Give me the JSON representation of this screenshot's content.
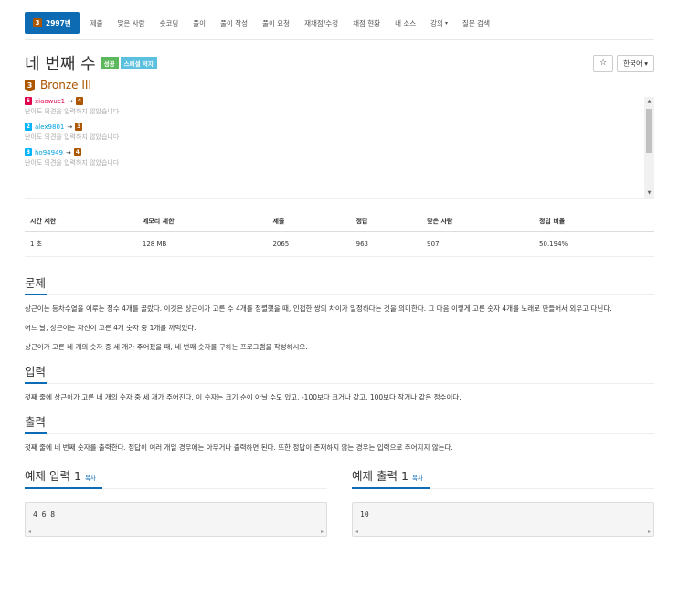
{
  "nav": {
    "tabs": [
      {
        "label": "2997번",
        "active": true
      },
      {
        "label": "제출"
      },
      {
        "label": "맞은 사람"
      },
      {
        "label": "숏코딩"
      },
      {
        "label": "풀이"
      },
      {
        "label": "풀이 작성"
      },
      {
        "label": "풀이 요청"
      },
      {
        "label": "재채점/수정"
      },
      {
        "label": "채점 현황"
      },
      {
        "label": "내 소스"
      },
      {
        "label": "강의"
      },
      {
        "label": "질문 검색"
      }
    ],
    "active_icon": "3"
  },
  "problem": {
    "title": "네 번째 수",
    "badge_success": "성공",
    "badge_special": "스페셜 저지",
    "tier_icon": "3",
    "tier_label": "Bronze III"
  },
  "tools": {
    "star": "☆",
    "language": "한국어"
  },
  "opinions": [
    {
      "level": "5",
      "level_tier": "ruby",
      "user": "xiaowuc1",
      "user_color": "red",
      "arrow": "→",
      "vote": "4",
      "note": "난이도 의견을 입력하지 않았습니다"
    },
    {
      "level": "2",
      "level_tier": "diamond",
      "user": "alex9801",
      "user_color": "blue",
      "arrow": "→",
      "vote": "3",
      "note": "난이도 의견을 입력하지 않았습니다"
    },
    {
      "level": "3",
      "level_tier": "diamond",
      "user": "ho94949",
      "user_color": "blue",
      "arrow": "→",
      "vote": "4",
      "note": "난이도 의견을 입력하지 않았습니다"
    }
  ],
  "info_table": {
    "headers": [
      "시간 제한",
      "메모리 제한",
      "제출",
      "정답",
      "맞은 사람",
      "정답 비율"
    ],
    "row": [
      "1 초",
      "128 MB",
      "2065",
      "963",
      "907",
      "50.194%"
    ]
  },
  "sections": {
    "problem_title": "문제",
    "problem_paragraphs": [
      "상근이는 등차수열을 이루는 정수 4개를 골랐다. 이것은 상근이가 고른 수 4개를 정렬했을 때, 인접한 쌍의 차이가 일정하다는 것을 의미한다. 그 다음 이렇게 고른 숫자 4개를 노래로 만들어서 외우고 다닌다.",
      "어느 날, 상근이는 자신이 고른 4개 숫자 중 1개를 까먹었다.",
      "상근이가 고른 네 개의 숫자 중 세 개가 주어졌을 때, 네 번째 숫자를 구하는 프로그램을 작성하시오."
    ],
    "input_title": "입력",
    "input_text": "첫째 줄에 상근이가 고른 네 개의 숫자 중 세 개가 주어진다. 이 숫자는 크기 순이 아닐 수도 있고, -100보다 크거나 같고, 100보다 작거나 같은 정수이다.",
    "output_title": "출력",
    "output_text": "첫째 줄에 네 번째 숫자를 출력한다. 정답이 여러 개일 경우에는 아무거나 출력하면 된다. 또한 정답이 존재하지 않는 경우는 입력으로 주어지지 않는다."
  },
  "examples": {
    "input": {
      "title": "예제 입력",
      "num": "1",
      "copy": "복사",
      "content": "4 6 8"
    },
    "output": {
      "title": "예제 출력",
      "num": "1",
      "copy": "복사",
      "content": "10"
    }
  },
  "colors": {
    "accent": "#0d6bb3",
    "bronze": "#ad5600",
    "success": "#5cb85c",
    "special": "#5bc0de"
  }
}
